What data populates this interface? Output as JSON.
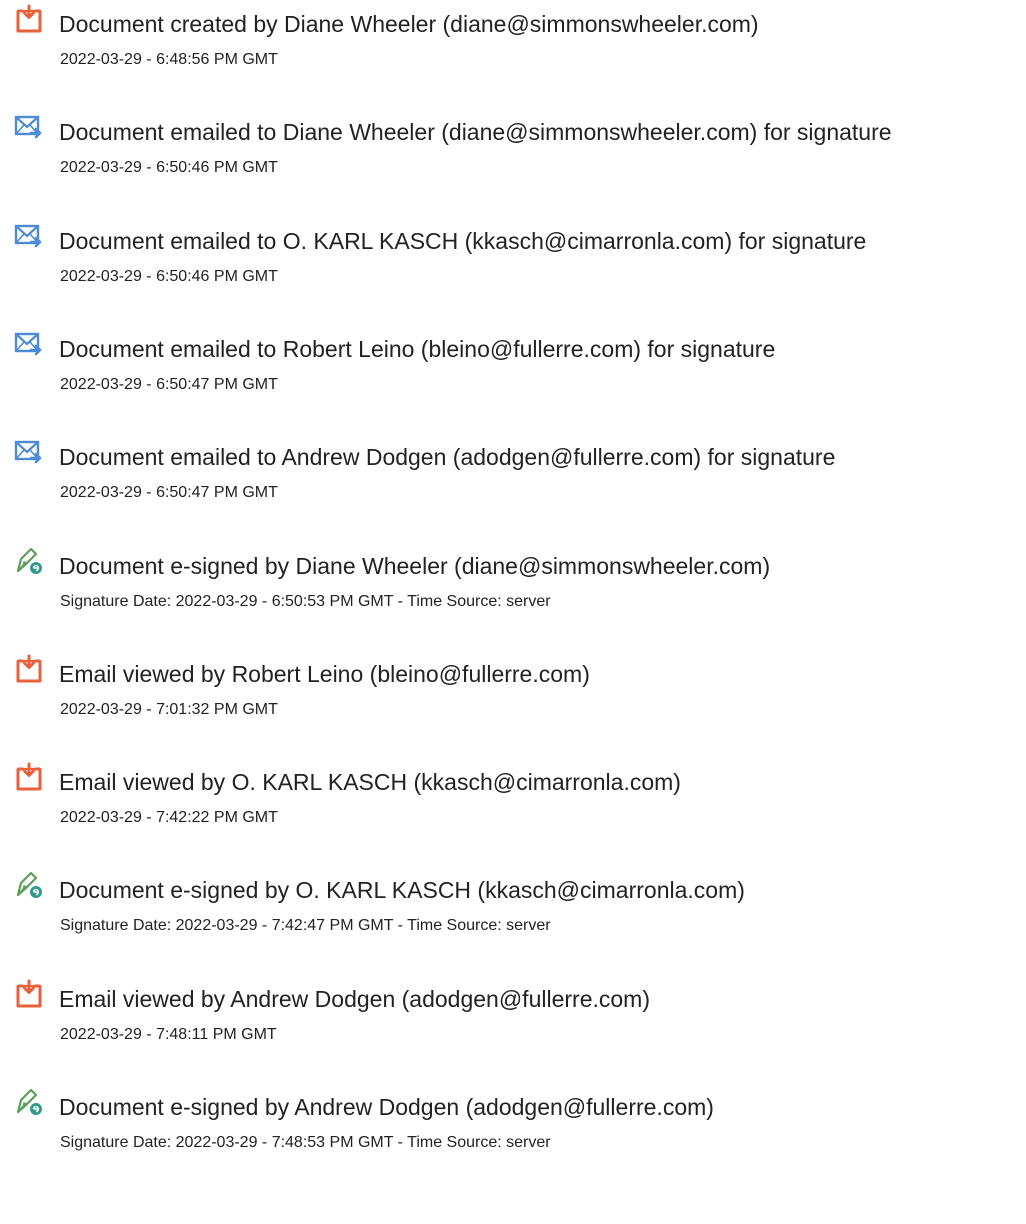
{
  "events": [
    {
      "type": "created",
      "icon": "document-created-icon",
      "title": "Document created by Diane Wheeler (diane@simmonswheeler.com)",
      "detail": "2022-03-29 - 6:48:56 PM GMT"
    },
    {
      "type": "emailed",
      "icon": "email-sent-icon",
      "title": "Document emailed to Diane Wheeler (diane@simmonswheeler.com) for signature",
      "detail": "2022-03-29 - 6:50:46 PM GMT"
    },
    {
      "type": "emailed",
      "icon": "email-sent-icon",
      "title": "Document emailed to O. KARL KASCH (kkasch@cimarronla.com) for signature",
      "detail": "2022-03-29 - 6:50:46 PM GMT"
    },
    {
      "type": "emailed",
      "icon": "email-sent-icon",
      "title": "Document emailed to Robert Leino (bleino@fullerre.com) for signature",
      "detail": "2022-03-29 - 6:50:47 PM GMT"
    },
    {
      "type": "emailed",
      "icon": "email-sent-icon",
      "title": "Document emailed to Andrew Dodgen (adodgen@fullerre.com) for signature",
      "detail": "2022-03-29 - 6:50:47 PM GMT"
    },
    {
      "type": "signed",
      "icon": "e-signature-icon",
      "title": "Document e-signed by Diane Wheeler (diane@simmonswheeler.com)",
      "detail": "Signature Date: 2022-03-29 - 6:50:53 PM GMT - Time Source: server"
    },
    {
      "type": "viewed",
      "icon": "document-viewed-icon",
      "title": "Email viewed by Robert Leino (bleino@fullerre.com)",
      "detail": "2022-03-29 - 7:01:32 PM GMT"
    },
    {
      "type": "viewed",
      "icon": "document-viewed-icon",
      "title": "Email viewed by O. KARL KASCH (kkasch@cimarronla.com)",
      "detail": "2022-03-29 - 7:42:22 PM GMT"
    },
    {
      "type": "signed",
      "icon": "e-signature-icon",
      "title": "Document e-signed by O. KARL KASCH (kkasch@cimarronla.com)",
      "detail": "Signature Date: 2022-03-29 - 7:42:47 PM GMT - Time Source: server"
    },
    {
      "type": "viewed",
      "icon": "document-viewed-icon",
      "title": "Email viewed by Andrew Dodgen (adodgen@fullerre.com)",
      "detail": "2022-03-29 - 7:48:11 PM GMT"
    },
    {
      "type": "signed",
      "icon": "e-signature-icon",
      "title": "Document e-signed by Andrew Dodgen (adodgen@fullerre.com)",
      "detail": "Signature Date: 2022-03-29 - 7:48:53 PM GMT - Time Source: server"
    }
  ],
  "colors": {
    "doc_icon": "#e8613c",
    "mail_icon": "#4e8bd6",
    "sign_icon": "#2f9a8a",
    "text": "#222222"
  }
}
